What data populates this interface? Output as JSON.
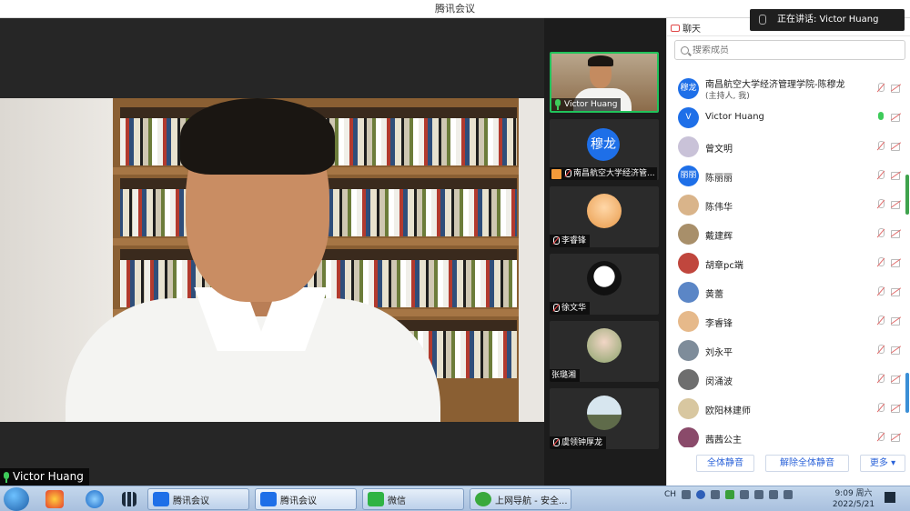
{
  "window": {
    "title": "腾讯会议"
  },
  "speaking_toast": "正在讲话: Victor Huang",
  "main_video": {
    "speaker_label": "Victor Huang"
  },
  "thumbnails": [
    {
      "label": "Victor Huang",
      "kind": "video"
    },
    {
      "label": "南昌航空大学经济管...",
      "kind": "avatar",
      "avatar_text": "穆龙",
      "host": true
    },
    {
      "label": "李睿锋",
      "kind": "image"
    },
    {
      "label": "徐文华",
      "kind": "image"
    },
    {
      "label": "张璐湘",
      "kind": "image"
    },
    {
      "label": "虞领钟厚龙",
      "kind": "image"
    }
  ],
  "panel": {
    "chat_tab": "聊天",
    "search_placeholder": "搜索成员",
    "members": [
      {
        "name": "南昌航空大学经济管理学院-陈穆龙",
        "sub": "(主持人, 我)",
        "avatar_text": "穆龙",
        "avatar_color": "#1e6fe8",
        "mic": "off"
      },
      {
        "name": "Victor Huang",
        "avatar_text": "V",
        "avatar_color": "#1e6fe8",
        "mic": "on"
      },
      {
        "name": "曾文明",
        "avatar_text": "",
        "avatar_color": "#c9c2d8",
        "mic": "off"
      },
      {
        "name": "陈丽丽",
        "avatar_text": "丽丽",
        "avatar_color": "#1e6fe8",
        "mic": "off"
      },
      {
        "name": "陈伟华",
        "avatar_text": "",
        "avatar_color": "#d9b48a",
        "mic": "off"
      },
      {
        "name": "戴建辉",
        "avatar_text": "",
        "avatar_color": "#a88f6a",
        "mic": "off"
      },
      {
        "name": "胡章pc端",
        "avatar_text": "",
        "avatar_color": "#c0463d",
        "mic": "off"
      },
      {
        "name": "黄蕾",
        "avatar_text": "",
        "avatar_color": "#5b86c6",
        "mic": "off"
      },
      {
        "name": "李睿锋",
        "avatar_text": "",
        "avatar_color": "#e6b98a",
        "mic": "off"
      },
      {
        "name": "刘永平",
        "avatar_text": "",
        "avatar_color": "#7e8c9a",
        "mic": "off"
      },
      {
        "name": "闵涌波",
        "avatar_text": "",
        "avatar_color": "#6e6e6e",
        "mic": "off"
      },
      {
        "name": "欧阳林建师",
        "avatar_text": "",
        "avatar_color": "#d8c7a0",
        "mic": "off"
      },
      {
        "name": "茜茜公主",
        "avatar_text": "",
        "avatar_color": "#8a4a6a",
        "mic": "off"
      }
    ],
    "buttons": {
      "mute_all": "全体静音",
      "unmute_all": "解除全体静音",
      "more": "更多 ▾"
    }
  },
  "taskbar": {
    "items": [
      {
        "label": "腾讯会议",
        "color": "#1e6fe8"
      },
      {
        "label": "腾讯会议",
        "color": "#1e6fe8"
      },
      {
        "label": "微信",
        "color": "#2fb344"
      },
      {
        "label": "上网导航 - 安全...",
        "color": "#3aa93c"
      }
    ],
    "tray_lang": "CH",
    "time": "9:09 周六",
    "date": "2022/5/21"
  }
}
